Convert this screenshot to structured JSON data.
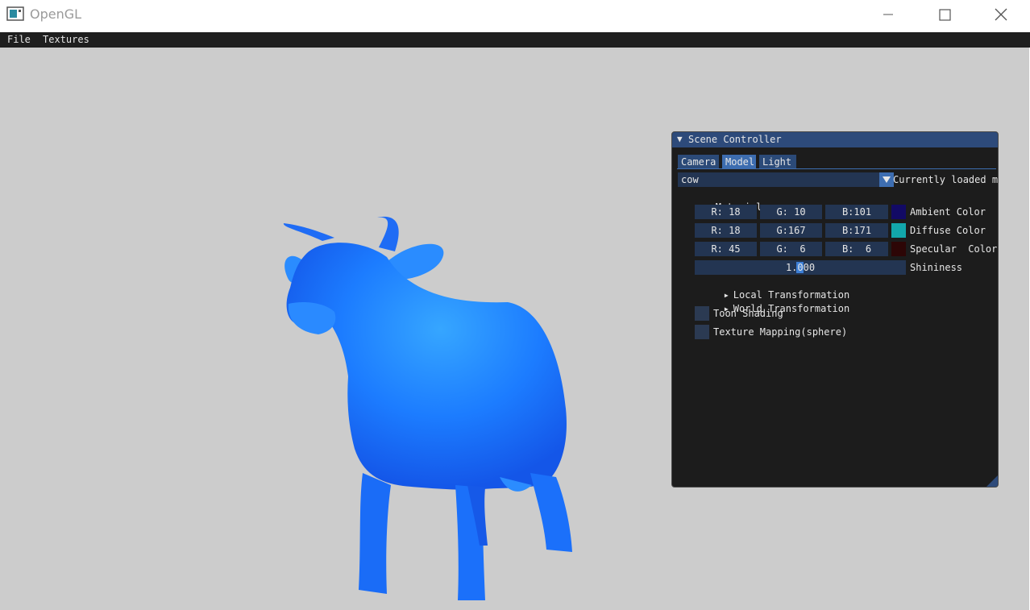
{
  "window": {
    "title": "OpenGL",
    "controls": [
      "minimize-icon",
      "maximize-icon",
      "close-icon"
    ]
  },
  "menubar": {
    "items": [
      "File",
      "Textures"
    ]
  },
  "viewport": {
    "background": "#cccccc",
    "model_color": "#1a73ff"
  },
  "panel": {
    "title": "Scene Controller",
    "tabs": [
      "Camera",
      "Model",
      "Light"
    ],
    "active_tab": "Model",
    "model_combo": {
      "value": "cow",
      "label": "Currently loaded m"
    },
    "material": {
      "header": "Material",
      "ambient": {
        "r": "R: 18",
        "g": "G: 10",
        "b": "B:101",
        "label": "Ambient Color",
        "swatch": "#120a65"
      },
      "diffuse": {
        "r": "R: 18",
        "g": "G:167",
        "b": "B:171",
        "label": "Diffuse Color",
        "swatch": "#12a7ab"
      },
      "specular": {
        "r": "R: 45",
        "g": "G:  6",
        "b": "B:  6",
        "label": "Specular  Color",
        "swatch": "#2d0606"
      },
      "shininess": {
        "value": "1.000",
        "label": "Shininess"
      }
    },
    "local_transformation": "Local Transformation",
    "world_transformation": "World Transformation",
    "toon_shading": "Toon Shading",
    "texture_mapping": "Texture Mapping(sphere)"
  }
}
